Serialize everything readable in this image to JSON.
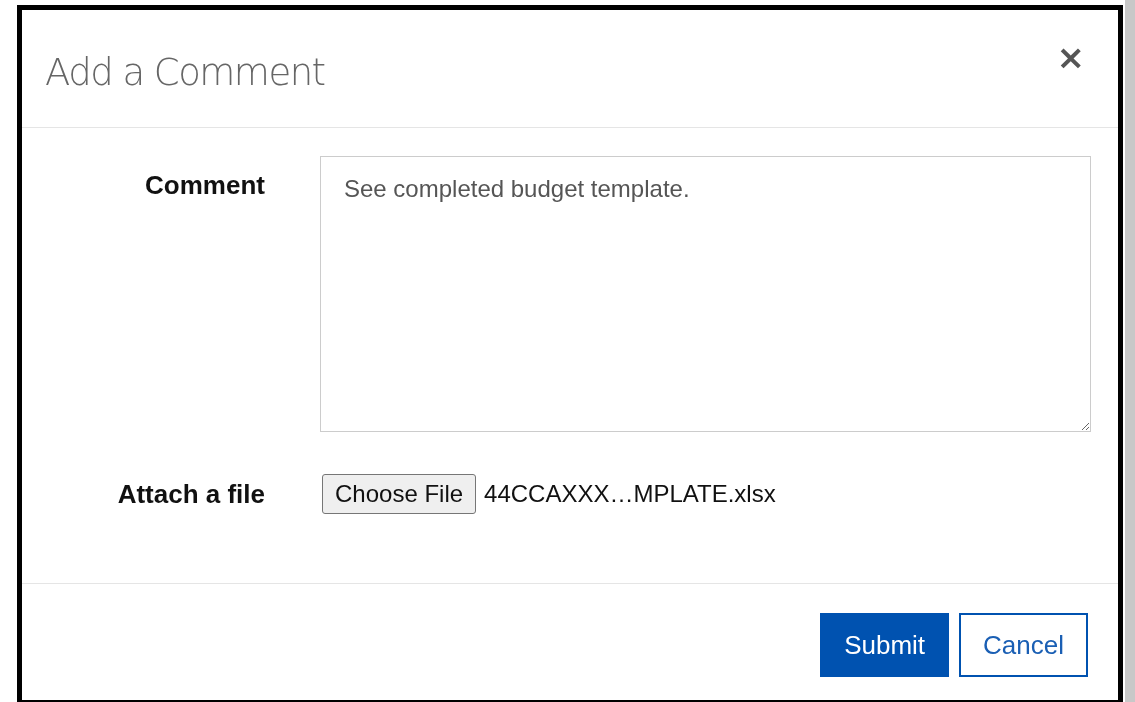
{
  "dialog": {
    "title": "Add a Comment",
    "close": "×"
  },
  "comment": {
    "label": "Comment",
    "value": "See completed budget template."
  },
  "attachment": {
    "label": "Attach a file",
    "button": "Choose File",
    "file_name": "44CCAXXX…MPLATE.xlsx"
  },
  "buttons": [
    {
      "label": "Submit",
      "kind": "primary"
    },
    {
      "label": "Cancel",
      "kind": "secondary"
    }
  ]
}
